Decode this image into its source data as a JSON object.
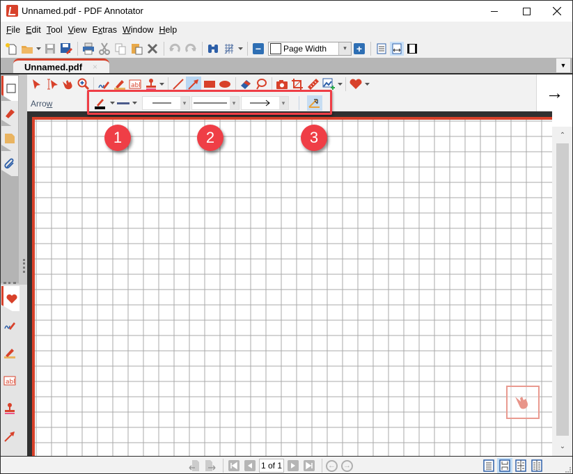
{
  "window": {
    "title": "Unnamed.pdf - PDF Annotator",
    "controls": [
      "minimize",
      "maximize",
      "close"
    ]
  },
  "menu": [
    {
      "label": "File",
      "mnemonic": "F",
      "rest": "ile"
    },
    {
      "label": "Edit",
      "mnemonic": "E",
      "rest": "dit"
    },
    {
      "label": "Tool",
      "mnemonic": "T",
      "rest": "ool"
    },
    {
      "label": "View",
      "mnemonic": "V",
      "rest": "iew"
    },
    {
      "label": "Extras",
      "pre": "E",
      "mnemonic": "x",
      "rest": "tras"
    },
    {
      "label": "Window",
      "mnemonic": "W",
      "rest": "indow"
    },
    {
      "label": "Help",
      "mnemonic": "H",
      "rest": "elp"
    }
  ],
  "toolbar": {
    "icons": [
      "new-document-icon",
      "open-folder-icon",
      "save-icon",
      "save-as-icon",
      "print-icon",
      "cut-icon",
      "copy-icon",
      "paste-icon",
      "delete-icon",
      "undo-icon",
      "redo-icon",
      "find-icon",
      "grid-icon",
      "zoom-out-icon",
      "zoom-in-icon",
      "single-page-icon",
      "page-width-icon",
      "full-screen-icon"
    ],
    "zoom_value": "Page Width"
  },
  "tabs": [
    {
      "label": "Unnamed.pdf",
      "close": "×",
      "active": true
    }
  ],
  "sidebar": {
    "upper_tabs": [
      "pages-icon",
      "bookmark-icon",
      "note-icon",
      "attachment-icon"
    ],
    "lower_tabs": [
      "favorites-heart-icon",
      "pen-icon",
      "highlighter-icon",
      "text-box-icon",
      "stamp-icon",
      "arrow-icon"
    ]
  },
  "palette": {
    "tools": [
      "select-icon",
      "text-select-icon",
      "hand-icon",
      "magnifier-icon",
      "pen-icon",
      "highlighter-icon",
      "text-box-icon",
      "stamp-icon",
      "line-icon",
      "arrow-icon",
      "rectangle-icon",
      "ellipse-icon",
      "eraser-icon",
      "lasso-icon",
      "camera-icon",
      "crop-icon",
      "ruler-icon",
      "insert-image-icon",
      "favorites-icon"
    ],
    "active_tool": "arrow-icon",
    "tool_name": {
      "pre": "Arro",
      "mnemonic": "w",
      "rest": ""
    },
    "properties": {
      "color": "#000000",
      "width_color": "#4b5a8a",
      "line_style": "solid",
      "line_start": "none",
      "line_end": "arrow",
      "angle_snap": true
    }
  },
  "arrow_preview": "→",
  "badges": [
    {
      "label": "1"
    },
    {
      "label": "2"
    },
    {
      "label": "3"
    }
  ],
  "statusbar": {
    "page_field": "1 of 1",
    "nav": [
      "rotate-left-icon",
      "rotate-right-icon",
      "first-page-icon",
      "previous-page-icon",
      "next-page-icon",
      "last-page-icon",
      "back-icon",
      "forward-icon"
    ],
    "layouts": [
      "single-page-layout-icon",
      "continuous-layout-icon",
      "two-page-layout-icon",
      "two-page-continuous-layout-icon"
    ],
    "active_layout": 1
  },
  "colors": {
    "accent_red": "#d8412a",
    "highlight_red": "#ef3e46",
    "selection_blue": "#b9d7f3"
  }
}
